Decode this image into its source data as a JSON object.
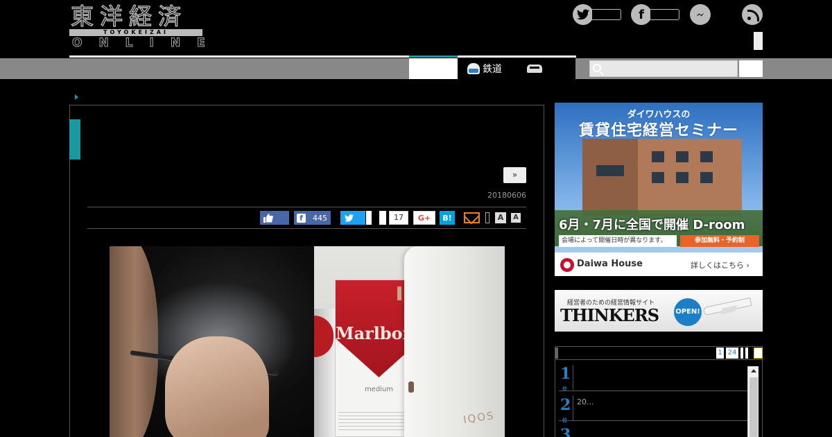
{
  "header": {
    "logo_jp": "東洋経済",
    "logo_romaji": "TOYOKEIZAI",
    "logo_online": "ONLINE",
    "social_icons": [
      "twitter-icon",
      "facebook-icon",
      "messenger-icon",
      "rss-icon"
    ]
  },
  "nav": {
    "items": [
      {
        "label": "鉄道",
        "icon": "train-icon"
      },
      {
        "label": "",
        "icon": "car-icon"
      }
    ],
    "search_icon": "search-icon"
  },
  "article": {
    "more_label": "»",
    "date": "20180606",
    "share": {
      "facebook_count": "445",
      "google_plus_count": "17",
      "google_plus_label": "G+",
      "hatena_label": "B!",
      "font_small": "A",
      "font_large": "A"
    },
    "photo": {
      "pack_brand": "Marlboro",
      "pack_variant": "medium",
      "device_brand": "IQOS"
    }
  },
  "sidebar": {
    "ad1": {
      "subtitle": "ダイワハウスの",
      "title": "賃貸住宅経営セミナー",
      "date_line": "6月・7月に全国で開催 D-room",
      "note": "会場によって開催日時が異なります。",
      "cta": "参加無料・予約制",
      "brand": "Daiwa House",
      "link": "詳しくはこちら ›"
    },
    "ad2": {
      "subtitle": "経営者のための経営情報サイト",
      "title": "THINKERS",
      "badge": "OPEN!"
    },
    "ranking": {
      "tabs": [
        "1",
        "24"
      ],
      "last_tab": "",
      "items": [
        {
          "rank": "1",
          "unit": "位",
          "text": ""
        },
        {
          "rank": "2",
          "unit": "位",
          "text": "20..."
        },
        {
          "rank": "3",
          "unit": "位",
          "text": ""
        }
      ]
    }
  }
}
